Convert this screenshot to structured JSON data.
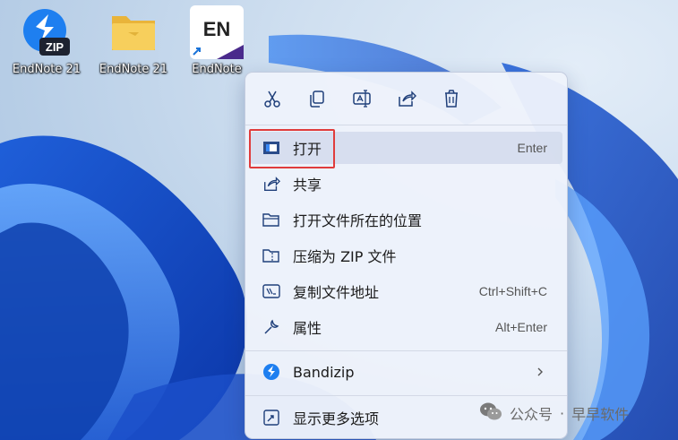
{
  "desktop": {
    "icons": [
      {
        "label": "EndNote 21",
        "icon": "bandizip-zip-icon"
      },
      {
        "label": "EndNote 21",
        "icon": "folder-icon"
      },
      {
        "label": "EndNote",
        "icon": "endnote-shortcut-icon",
        "badge": "EN"
      }
    ],
    "zip_badge": "ZIP"
  },
  "context_menu": {
    "toolbar": [
      {
        "name": "cut",
        "icon": "scissors-icon"
      },
      {
        "name": "copy",
        "icon": "copy-icon"
      },
      {
        "name": "rename",
        "icon": "rename-icon"
      },
      {
        "name": "share",
        "icon": "share-icon"
      },
      {
        "name": "delete",
        "icon": "trash-icon"
      }
    ],
    "items": [
      {
        "label": "打开",
        "shortcut": "Enter",
        "icon": "app-window-icon",
        "highlighted": true
      },
      {
        "label": "共享",
        "shortcut": "",
        "icon": "share-icon"
      },
      {
        "label": "打开文件所在的位置",
        "shortcut": "",
        "icon": "folder-open-icon"
      },
      {
        "label": "压缩为 ZIP 文件",
        "shortcut": "",
        "icon": "zip-folder-icon"
      },
      {
        "label": "复制文件地址",
        "shortcut": "Ctrl+Shift+C",
        "icon": "copy-path-icon"
      },
      {
        "label": "属性",
        "shortcut": "Alt+Enter",
        "icon": "wrench-icon"
      }
    ],
    "bandizip": {
      "label": "Bandizip",
      "icon": "bandizip-icon",
      "has_submenu": true
    },
    "more": {
      "label": "显示更多选项",
      "icon": "more-options-icon"
    }
  },
  "watermark": {
    "account": "公众号",
    "separator": "·",
    "name": "早早软件"
  },
  "colors": {
    "highlight_box": "#e03c3c",
    "menu_bg": "#eef2fb",
    "accent": "#1a73d9"
  }
}
